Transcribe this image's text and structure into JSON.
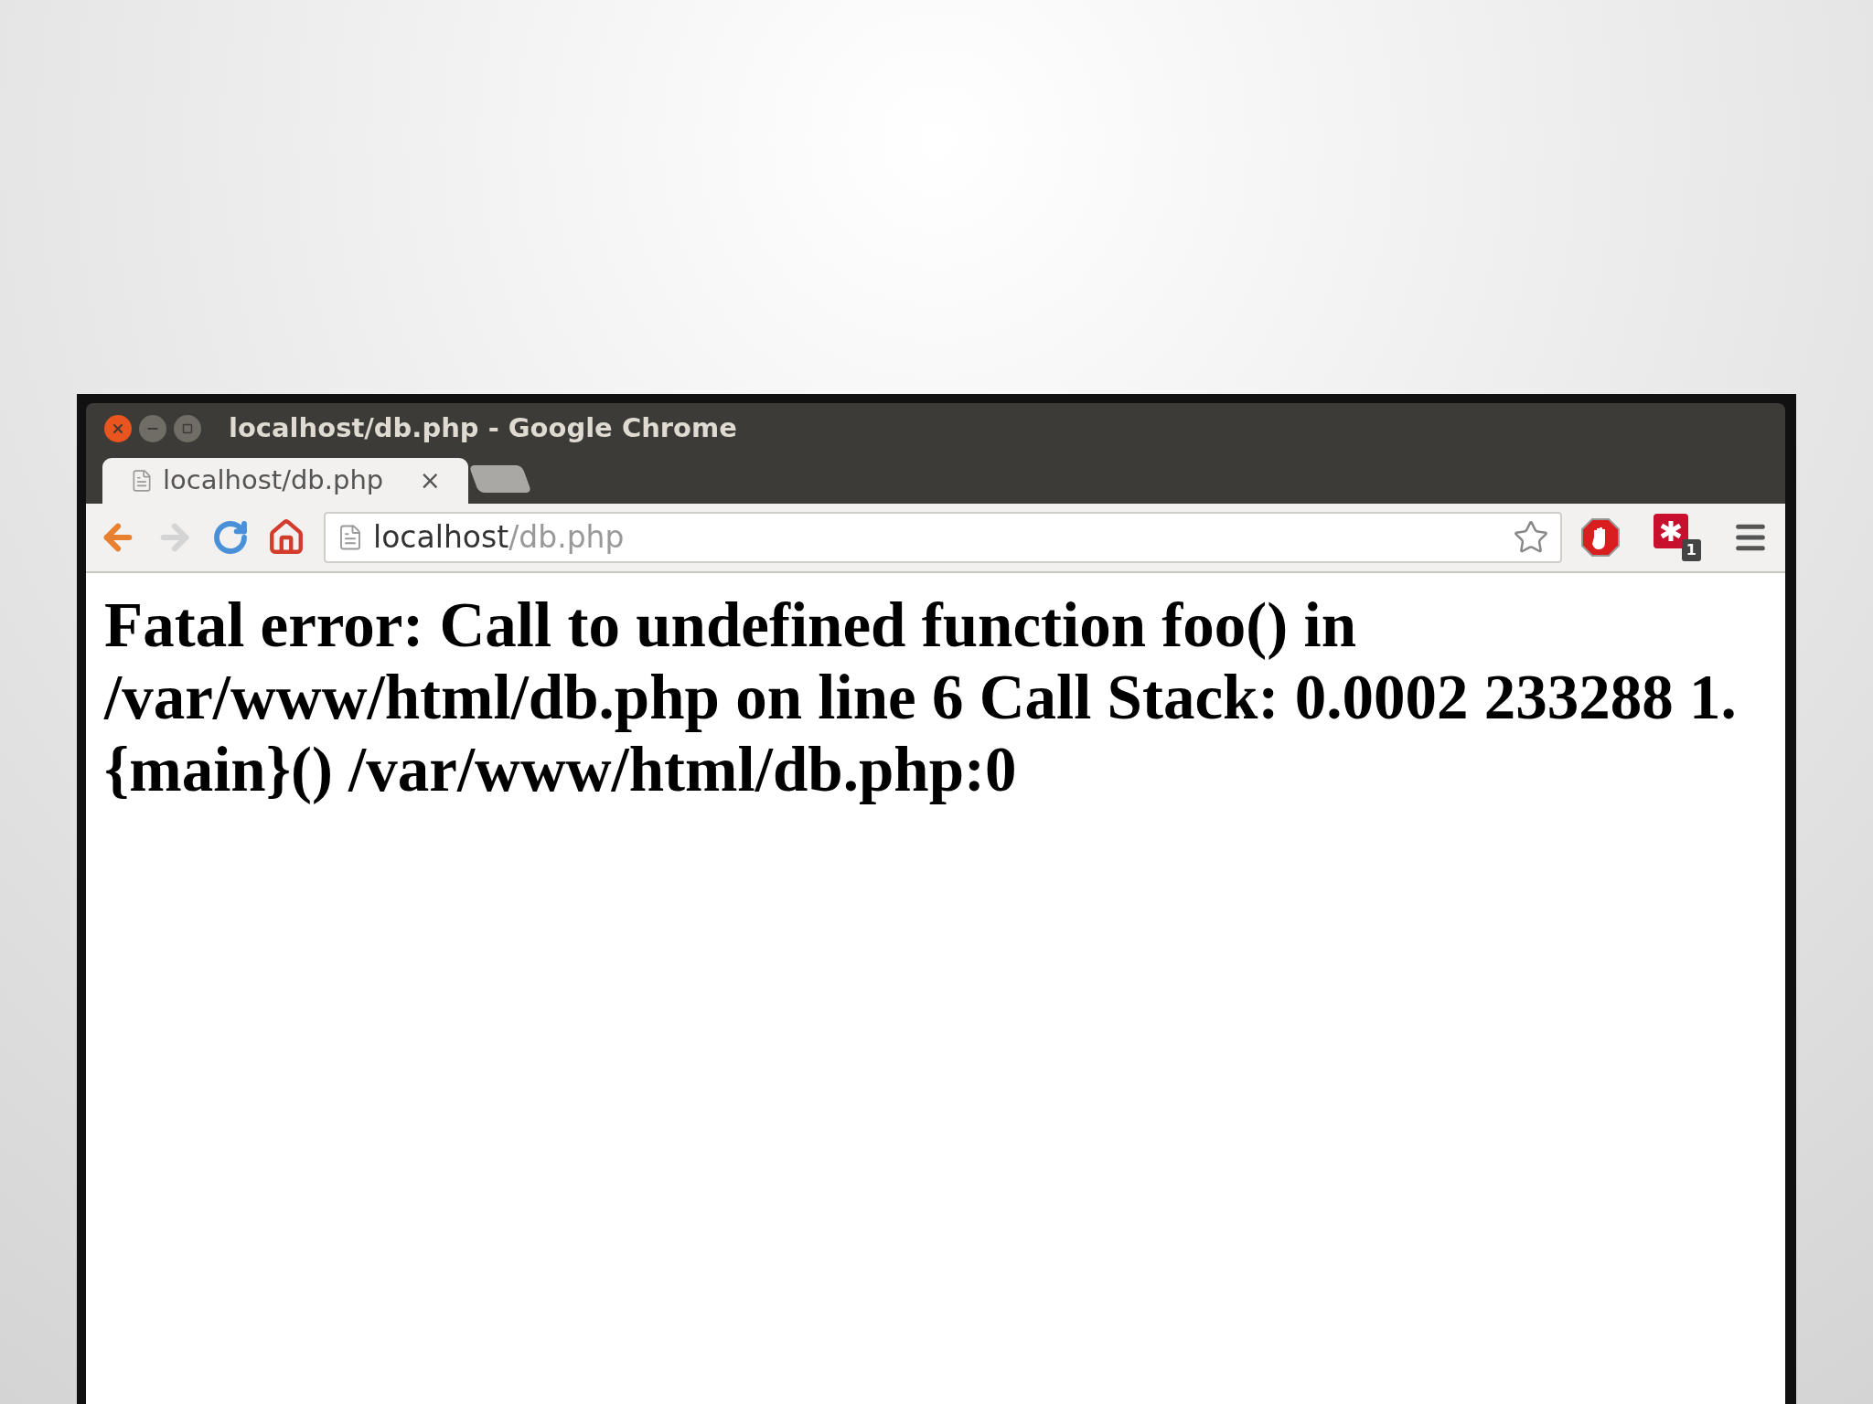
{
  "window": {
    "title": "localhost/db.php - Google Chrome"
  },
  "tabs": [
    {
      "label": "localhost/db.php",
      "selected": true,
      "close": "×"
    }
  ],
  "address_bar": {
    "host": "localhost",
    "path": "/db.php"
  },
  "extension_badge": "1",
  "page": {
    "error": "Fatal error: Call to undefined function foo() in /var/www/html/db.php on line 6 Call Stack: 0.0002 233288 1. {main}() /var/www/html/db.php:0"
  }
}
